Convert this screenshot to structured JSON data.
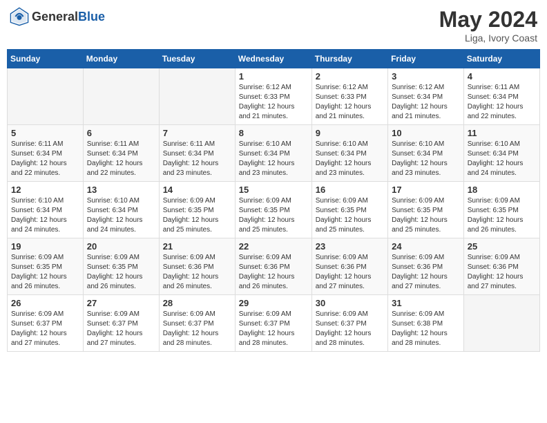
{
  "header": {
    "logo_general": "General",
    "logo_blue": "Blue",
    "month": "May 2024",
    "location": "Liga, Ivory Coast"
  },
  "calendar": {
    "days_of_week": [
      "Sunday",
      "Monday",
      "Tuesday",
      "Wednesday",
      "Thursday",
      "Friday",
      "Saturday"
    ],
    "weeks": [
      [
        {
          "day": "",
          "info": ""
        },
        {
          "day": "",
          "info": ""
        },
        {
          "day": "",
          "info": ""
        },
        {
          "day": "1",
          "info": "Sunrise: 6:12 AM\nSunset: 6:33 PM\nDaylight: 12 hours\nand 21 minutes."
        },
        {
          "day": "2",
          "info": "Sunrise: 6:12 AM\nSunset: 6:33 PM\nDaylight: 12 hours\nand 21 minutes."
        },
        {
          "day": "3",
          "info": "Sunrise: 6:12 AM\nSunset: 6:34 PM\nDaylight: 12 hours\nand 21 minutes."
        },
        {
          "day": "4",
          "info": "Sunrise: 6:11 AM\nSunset: 6:34 PM\nDaylight: 12 hours\nand 22 minutes."
        }
      ],
      [
        {
          "day": "5",
          "info": "Sunrise: 6:11 AM\nSunset: 6:34 PM\nDaylight: 12 hours\nand 22 minutes."
        },
        {
          "day": "6",
          "info": "Sunrise: 6:11 AM\nSunset: 6:34 PM\nDaylight: 12 hours\nand 22 minutes."
        },
        {
          "day": "7",
          "info": "Sunrise: 6:11 AM\nSunset: 6:34 PM\nDaylight: 12 hours\nand 23 minutes."
        },
        {
          "day": "8",
          "info": "Sunrise: 6:10 AM\nSunset: 6:34 PM\nDaylight: 12 hours\nand 23 minutes."
        },
        {
          "day": "9",
          "info": "Sunrise: 6:10 AM\nSunset: 6:34 PM\nDaylight: 12 hours\nand 23 minutes."
        },
        {
          "day": "10",
          "info": "Sunrise: 6:10 AM\nSunset: 6:34 PM\nDaylight: 12 hours\nand 23 minutes."
        },
        {
          "day": "11",
          "info": "Sunrise: 6:10 AM\nSunset: 6:34 PM\nDaylight: 12 hours\nand 24 minutes."
        }
      ],
      [
        {
          "day": "12",
          "info": "Sunrise: 6:10 AM\nSunset: 6:34 PM\nDaylight: 12 hours\nand 24 minutes."
        },
        {
          "day": "13",
          "info": "Sunrise: 6:10 AM\nSunset: 6:34 PM\nDaylight: 12 hours\nand 24 minutes."
        },
        {
          "day": "14",
          "info": "Sunrise: 6:09 AM\nSunset: 6:35 PM\nDaylight: 12 hours\nand 25 minutes."
        },
        {
          "day": "15",
          "info": "Sunrise: 6:09 AM\nSunset: 6:35 PM\nDaylight: 12 hours\nand 25 minutes."
        },
        {
          "day": "16",
          "info": "Sunrise: 6:09 AM\nSunset: 6:35 PM\nDaylight: 12 hours\nand 25 minutes."
        },
        {
          "day": "17",
          "info": "Sunrise: 6:09 AM\nSunset: 6:35 PM\nDaylight: 12 hours\nand 25 minutes."
        },
        {
          "day": "18",
          "info": "Sunrise: 6:09 AM\nSunset: 6:35 PM\nDaylight: 12 hours\nand 26 minutes."
        }
      ],
      [
        {
          "day": "19",
          "info": "Sunrise: 6:09 AM\nSunset: 6:35 PM\nDaylight: 12 hours\nand 26 minutes."
        },
        {
          "day": "20",
          "info": "Sunrise: 6:09 AM\nSunset: 6:35 PM\nDaylight: 12 hours\nand 26 minutes."
        },
        {
          "day": "21",
          "info": "Sunrise: 6:09 AM\nSunset: 6:36 PM\nDaylight: 12 hours\nand 26 minutes."
        },
        {
          "day": "22",
          "info": "Sunrise: 6:09 AM\nSunset: 6:36 PM\nDaylight: 12 hours\nand 26 minutes."
        },
        {
          "day": "23",
          "info": "Sunrise: 6:09 AM\nSunset: 6:36 PM\nDaylight: 12 hours\nand 27 minutes."
        },
        {
          "day": "24",
          "info": "Sunrise: 6:09 AM\nSunset: 6:36 PM\nDaylight: 12 hours\nand 27 minutes."
        },
        {
          "day": "25",
          "info": "Sunrise: 6:09 AM\nSunset: 6:36 PM\nDaylight: 12 hours\nand 27 minutes."
        }
      ],
      [
        {
          "day": "26",
          "info": "Sunrise: 6:09 AM\nSunset: 6:37 PM\nDaylight: 12 hours\nand 27 minutes."
        },
        {
          "day": "27",
          "info": "Sunrise: 6:09 AM\nSunset: 6:37 PM\nDaylight: 12 hours\nand 27 minutes."
        },
        {
          "day": "28",
          "info": "Sunrise: 6:09 AM\nSunset: 6:37 PM\nDaylight: 12 hours\nand 28 minutes."
        },
        {
          "day": "29",
          "info": "Sunrise: 6:09 AM\nSunset: 6:37 PM\nDaylight: 12 hours\nand 28 minutes."
        },
        {
          "day": "30",
          "info": "Sunrise: 6:09 AM\nSunset: 6:37 PM\nDaylight: 12 hours\nand 28 minutes."
        },
        {
          "day": "31",
          "info": "Sunrise: 6:09 AM\nSunset: 6:38 PM\nDaylight: 12 hours\nand 28 minutes."
        },
        {
          "day": "",
          "info": ""
        }
      ]
    ]
  }
}
